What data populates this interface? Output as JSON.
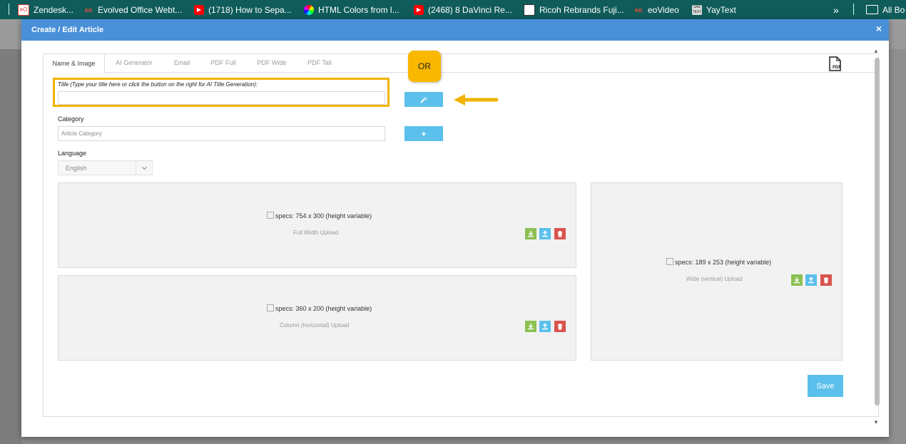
{
  "bookmarks": [
    {
      "label": "Zendesk...",
      "icon": "eo-logo-icon",
      "color": "#d23b2f"
    },
    {
      "label": "Evolved Office Webt...",
      "icon": "eo-logo-icon",
      "color": "#c0392b"
    },
    {
      "label": "(1718) How to Sepa...",
      "icon": "youtube-icon",
      "color": "#ff0000"
    },
    {
      "label": "HTML Colors from l...",
      "icon": "color-wheel-icon",
      "color": "#4caf50"
    },
    {
      "label": "(2468) 8 DaVinci Re...",
      "icon": "youtube-icon",
      "color": "#ff0000"
    },
    {
      "label": "Ricoh Rebrands Fuji...",
      "icon": "page-icon",
      "color": "#ffffff"
    },
    {
      "label": "eoVideo",
      "icon": "eo-logo-icon",
      "color": "#c0392b"
    },
    {
      "label": "YayText",
      "icon": "yaytext-icon",
      "color": "#e0e0e0"
    }
  ],
  "bookmarks_more": "»",
  "all_bookmarks": "All Bo",
  "modal": {
    "title": "Create / Edit Article",
    "close": "×"
  },
  "tabs": [
    "Name & Image",
    "AI Generator",
    "Email",
    "PDF Full",
    "PDF Wide",
    "PDF Tall"
  ],
  "pdf_label": "PDF",
  "form": {
    "title_label": "Title (Type your title here or click the button on the right for AI Title Generation):",
    "title_value": "",
    "category_label": "Category",
    "category_placeholder": "Article Category",
    "category_add": "+",
    "language_label": "Language",
    "language_value": "English"
  },
  "annotation": {
    "or": "OR"
  },
  "uploads": {
    "full": {
      "spec": "specs: 754 x 300 (height variable)",
      "label": "Full Width Upload"
    },
    "column": {
      "spec": "specs: 360 x 200 (height variable)",
      "label": "Column (horizontal) Upload"
    },
    "wide": {
      "spec": "specs: 189 x 253 (height variable)",
      "label": "Wide (vertical) Upload"
    }
  },
  "save_label": "Save",
  "colors": {
    "header": "#4a90d9",
    "accent_blue": "#5bc0eb",
    "highlight": "#f0b400",
    "green": "#8cc152",
    "red": "#d9534f"
  }
}
